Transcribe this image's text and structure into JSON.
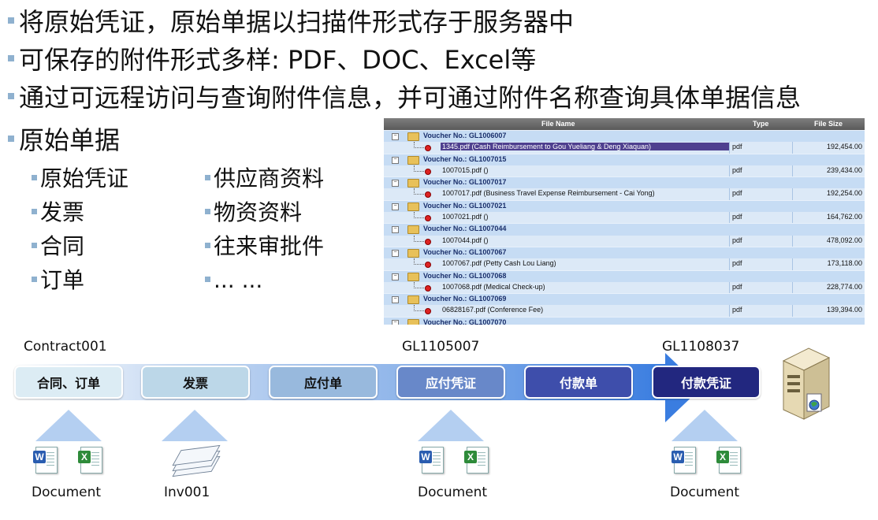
{
  "bullets": [
    "将原始凭证，原始单据以扫描件形式存于服务器中",
    "可保存的附件形式多样: PDF、DOC、Excel等",
    "通过可远程访问与查询附件信息，并可通过附件名称查询具体单据信息",
    "原始单据"
  ],
  "sub_left": [
    "原始凭证",
    "发票",
    "合同",
    "订单"
  ],
  "sub_right": [
    "供应商资料",
    "物资资料",
    "往来审批件",
    "... ..."
  ],
  "table": {
    "headers": {
      "name": "File Name",
      "type": "Type",
      "size": "File Size"
    },
    "groups": [
      {
        "voucher": "Voucher No.: GL1006007",
        "file": "1345.pdf  (Cash Reimbursement to Gou Yueliang & Deng Xiaquan)",
        "type": "pdf",
        "size": "192,454.00",
        "selected": true
      },
      {
        "voucher": "Voucher No.: GL1007015",
        "file": "1007015.pdf  ()",
        "type": "pdf",
        "size": "239,434.00"
      },
      {
        "voucher": "Voucher No.: GL1007017",
        "file": "1007017.pdf  (Business Travel Expense Reimbursement - Cai Yong)",
        "type": "pdf",
        "size": "192,254.00"
      },
      {
        "voucher": "Voucher No.: GL1007021",
        "file": "1007021.pdf  ()",
        "type": "pdf",
        "size": "164,762.00"
      },
      {
        "voucher": "Voucher No.: GL1007044",
        "file": "1007044.pdf  ()",
        "type": "pdf",
        "size": "478,092.00"
      },
      {
        "voucher": "Voucher No.: GL1007067",
        "file": "1007067.pdf  (Petty Cash Lou Liang)",
        "type": "pdf",
        "size": "173,118.00"
      },
      {
        "voucher": "Voucher No.: GL1007068",
        "file": "1007068.pdf  (Medical Check-up)",
        "type": "pdf",
        "size": "228,774.00"
      },
      {
        "voucher": "Voucher No.: GL1007069",
        "file": "06828167.pdf  (Conference Fee)",
        "type": "pdf",
        "size": "139,394.00"
      },
      {
        "voucher": "Voucher No.: GL1007070",
        "file": null
      }
    ]
  },
  "flow": {
    "top_labels": [
      "Contract001",
      "GL1105007",
      "GL1108037"
    ],
    "steps": [
      {
        "label": "合同、订单",
        "bg": "#dcecf4",
        "fg": "#111111"
      },
      {
        "label": "发票",
        "bg": "#bcd7e8",
        "fg": "#111111"
      },
      {
        "label": "应付单",
        "bg": "#98b9dd",
        "fg": "#111111"
      },
      {
        "label": "应付凭证",
        "bg": "#6888c9",
        "fg": "#ffffff"
      },
      {
        "label": "付款单",
        "bg": "#3e4eab",
        "fg": "#ffffff"
      },
      {
        "label": "付款凭证",
        "bg": "#22277f",
        "fg": "#ffffff"
      }
    ],
    "bottom_labels": [
      "Document",
      "Inv001",
      "Document",
      "Document"
    ]
  }
}
